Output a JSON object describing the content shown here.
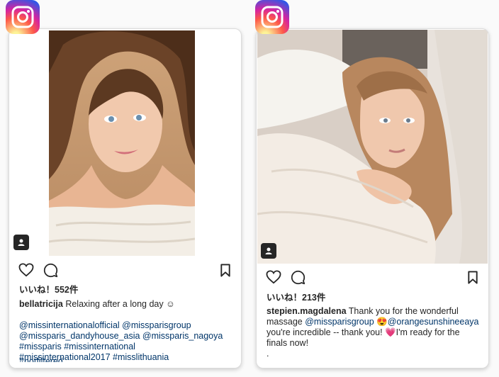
{
  "posts": [
    {
      "likes": "いいね！552件",
      "caption": {
        "username": "bellatricija",
        "text": "Relaxing after a long day ☺",
        "mentions_line1": "@missinternationalofficial @missparisgroup",
        "mentions_line2": "@missparis_dandyhouse_asia @missparis_nagoya",
        "hashtags_line1": "#missparis #missinternational",
        "hashtags_line2": "#missinternational2017 #misslithuania",
        "hashtags_cut": "#notfiltered"
      },
      "icons": [
        "instagram-logo-icon",
        "user-tag-icon",
        "heart-icon",
        "comment-icon",
        "bookmark-icon"
      ]
    },
    {
      "likes": "いいね！213件",
      "caption": {
        "username": "stepien.magdalena",
        "text_a": "Thank you for the wonderful",
        "text_b": "massage",
        "mention1": "@missparisgroup",
        "emoji1": "😍",
        "mention2": "@orangesunshineeaya",
        "text_c": "you're incredible -- thank you!",
        "emoji2": "💗",
        "text_d": "I'm ready for the",
        "text_e": "finals now!",
        "text_f": "."
      },
      "icons": [
        "instagram-logo-icon",
        "user-tag-icon",
        "heart-icon",
        "comment-icon",
        "bookmark-icon"
      ]
    }
  ],
  "colors": {
    "hashtag": "#003569",
    "text": "#262626",
    "card_border": "#dcdcdc"
  }
}
